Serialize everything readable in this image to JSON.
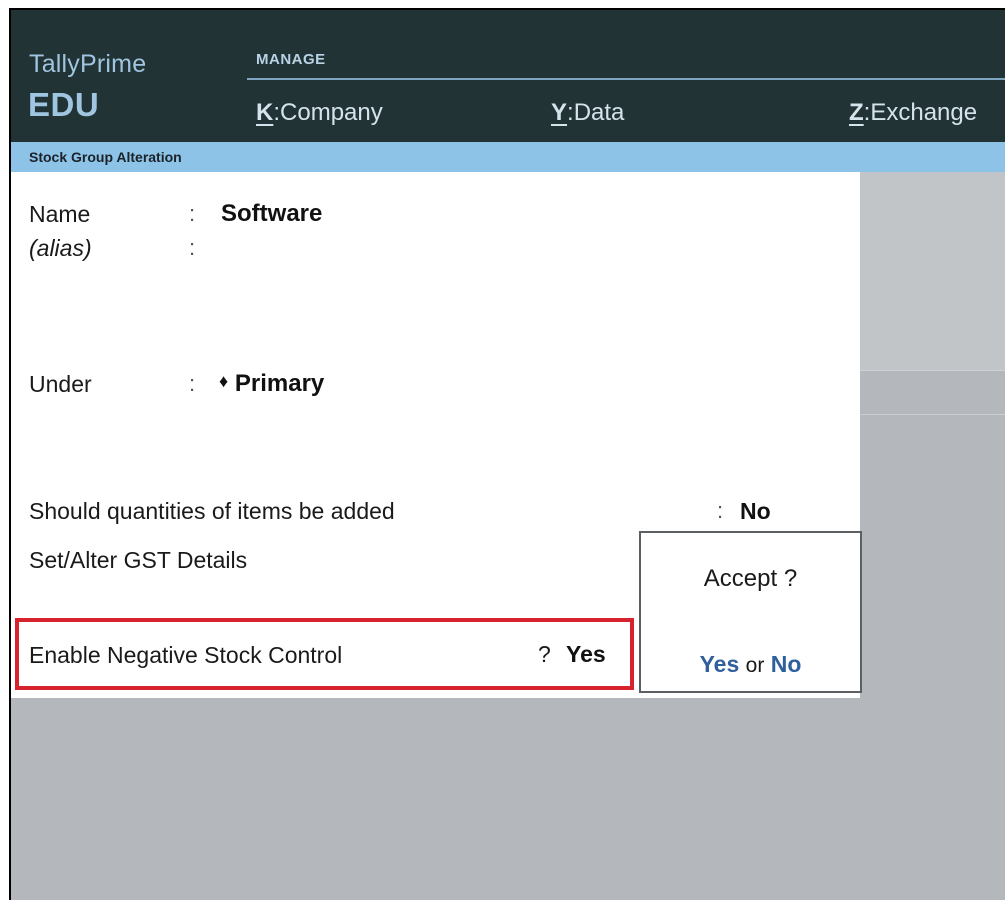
{
  "brand": {
    "name": "TallyPrime",
    "edition": "EDU"
  },
  "menu": {
    "section": "MANAGE",
    "items": [
      {
        "key": "K",
        "sep": ":",
        "label": "Company"
      },
      {
        "key": "Y",
        "sep": ":",
        "label": "Data"
      },
      {
        "key": "Z",
        "sep": ":",
        "label": "Exchange"
      }
    ]
  },
  "screen": {
    "title": "Stock Group Alteration"
  },
  "form": {
    "name": {
      "label": "Name",
      "colon": ":",
      "value": "Software"
    },
    "alias": {
      "label": "(alias)",
      "colon": ":",
      "value": ""
    },
    "under": {
      "label": "Under",
      "colon": ":",
      "bullet": "♦",
      "value": "Primary"
    },
    "quantities": {
      "label": "Should quantities of items be added",
      "colon": ":",
      "value": "No"
    },
    "gst": {
      "label": "Set/Alter GST Details"
    },
    "negative_stock": {
      "label": "Enable Negative Stock Control",
      "prompt": "?",
      "value": "Yes"
    }
  },
  "dialog": {
    "question": "Accept ?",
    "yes": "Yes",
    "or": "or",
    "no": "No"
  },
  "colors": {
    "header_bg": "#223336",
    "title_strip": "#8ec3e8",
    "highlight_border": "#d6232e",
    "choice_text": "#2f5f9c",
    "workspace_bg": "#b4b8bc"
  }
}
